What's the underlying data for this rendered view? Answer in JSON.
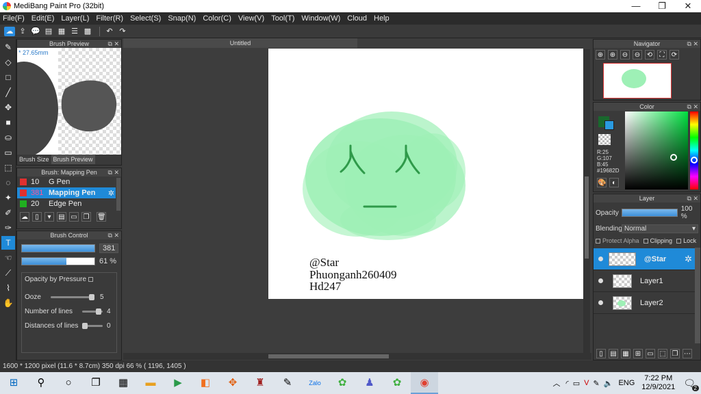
{
  "window": {
    "title": "MediBang Paint Pro (32bit)",
    "minimize": "—",
    "maximize": "❐",
    "close": "✕"
  },
  "menu": [
    "File(F)",
    "Edit(E)",
    "Layer(L)",
    "Filter(R)",
    "Select(S)",
    "Snap(N)",
    "Color(C)",
    "View(V)",
    "Tool(T)",
    "Window(W)",
    "Cloud",
    "Help"
  ],
  "brush_preview": {
    "title": "Brush Preview",
    "size_readout": "* 27.65mm",
    "tab_size": "Brush Size",
    "tab_preview": "Brush Preview"
  },
  "brush_list": {
    "title": "Brush: Mapping Pen",
    "items": [
      {
        "num": "10",
        "name": "G Pen",
        "color": "#e03030"
      },
      {
        "num": "381",
        "name": "Mapping Pen",
        "color": "#e03030"
      },
      {
        "num": "20",
        "name": "Edge Pen",
        "color": "#20b020"
      }
    ]
  },
  "brush_control": {
    "title": "Brush Control",
    "size_value": "381",
    "opacity_value": "61 %",
    "opacity_fraction": 0.61,
    "opacity_by_pressure": "Opacity by Pressure",
    "ooze_label": "Ooze",
    "ooze_value": "5",
    "lines_label": "Number of lines",
    "lines_value": "4",
    "dist_label": "Distances of lines",
    "dist_value": "0"
  },
  "canvas": {
    "tab": "Untitled",
    "signature": [
      "@Star",
      "Phuonganh260409",
      "Hd247"
    ],
    "blob_color": "#9ef0b6",
    "line_color": "#2f9a4a"
  },
  "navigator": {
    "title": "Navigator"
  },
  "color": {
    "title": "Color",
    "r": "R:25",
    "g": "G:107",
    "b": "B:45",
    "hex": "#19682D",
    "fg": "#19682D",
    "bg": "#2a9ae0"
  },
  "layer": {
    "title": "Layer",
    "opacity_label": "Opacity",
    "opacity_value": "100 %",
    "opacity_fraction": 1.0,
    "blending_label": "Blending",
    "blending_value": "Normal",
    "protect_alpha": "Protect Alpha",
    "clipping": "Clipping",
    "lock": "Lock",
    "items": [
      "@Star",
      "Layer1",
      "Layer2"
    ]
  },
  "status": {
    "text": "1600 * 1200 pixel   (11.6 * 8.7cm)   350 dpi   66 %   ( 1196, 1405 )"
  },
  "taskbar": {
    "time": "7:22 PM",
    "date": "12/9/2021",
    "lang": "ENG",
    "notif_count": "2"
  }
}
